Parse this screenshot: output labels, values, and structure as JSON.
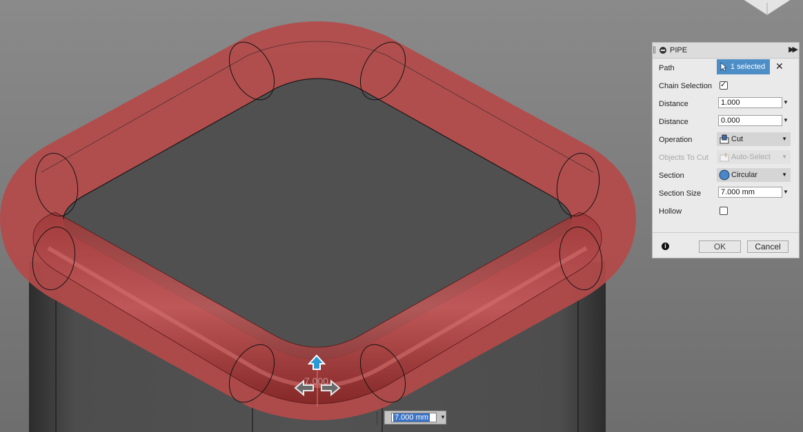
{
  "dialog": {
    "title": "PIPE",
    "path": {
      "label": "Path",
      "selection": "1 selected"
    },
    "chain_selection": {
      "label": "Chain Selection",
      "checked": true
    },
    "distance1": {
      "label": "Distance",
      "value": "1.000"
    },
    "distance2": {
      "label": "Distance",
      "value": "0.000"
    },
    "operation": {
      "label": "Operation",
      "value": "Cut"
    },
    "objects_to_cut": {
      "label": "Objects To Cut",
      "value": "Auto-Select"
    },
    "section": {
      "label": "Section",
      "value": "Circular"
    },
    "section_size": {
      "label": "Section Size",
      "value": "7.000 mm"
    },
    "hollow": {
      "label": "Hollow",
      "checked": false
    },
    "ok_label": "OK",
    "cancel_label": "Cancel"
  },
  "manipulator": {
    "dimension_label": "7.000",
    "input_value": "7.000 mm"
  },
  "colors": {
    "pipe": "#b44a4a",
    "pipe_dark": "#8e2828",
    "body": "#4a4a4a",
    "selection": "#4e8ec6"
  }
}
